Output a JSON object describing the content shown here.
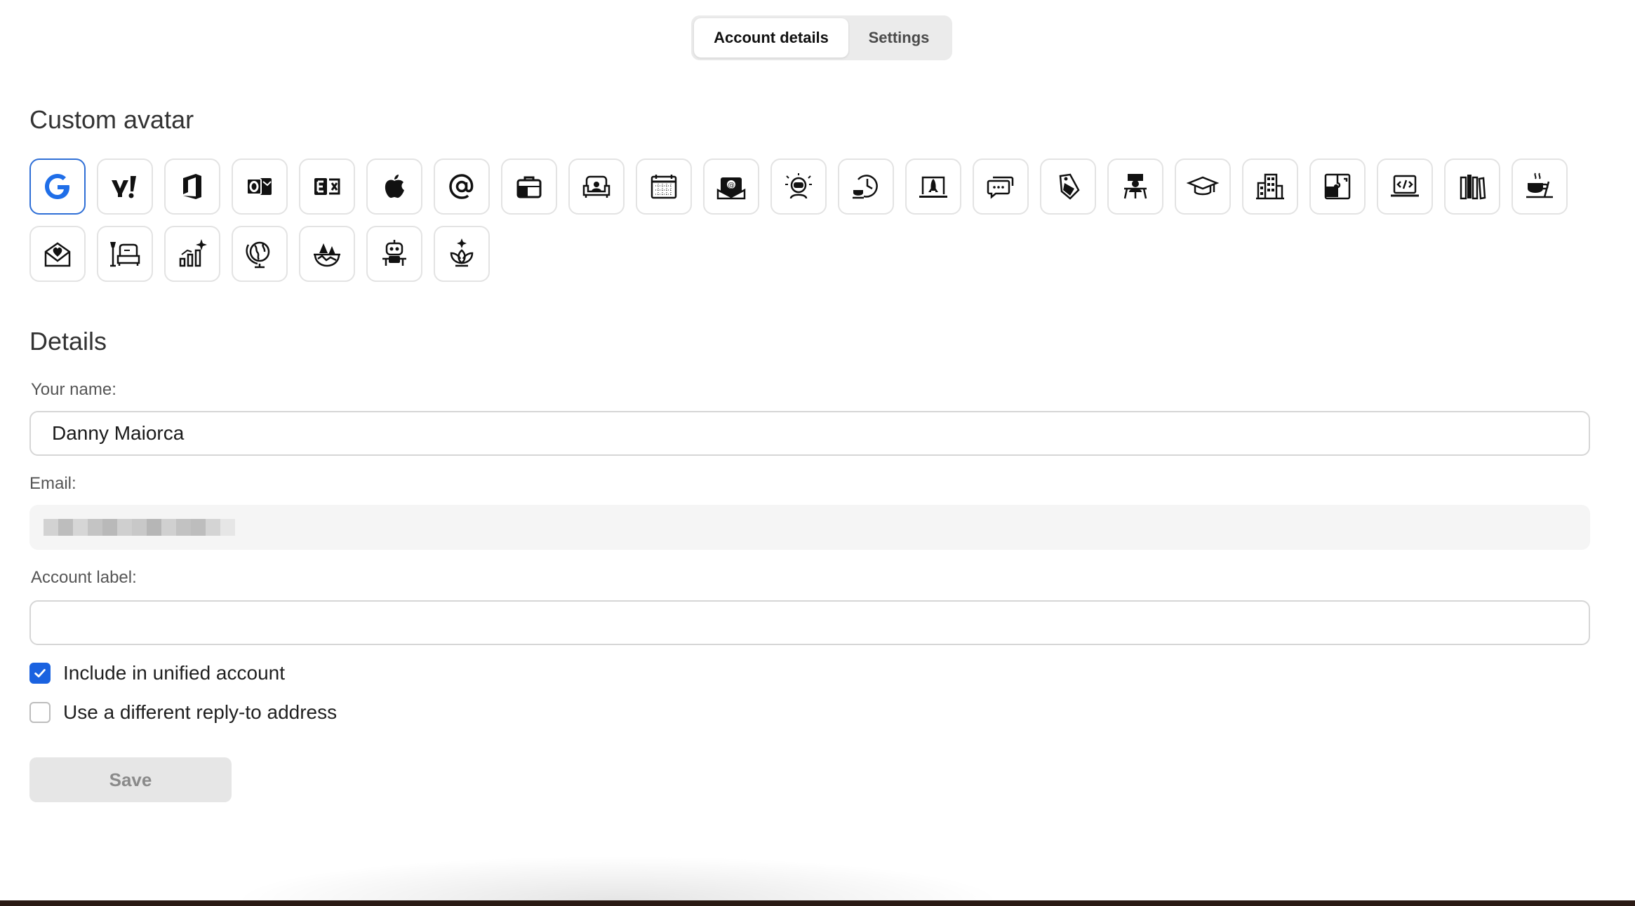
{
  "tabs": [
    {
      "label": "Account details",
      "active": true
    },
    {
      "label": "Settings",
      "active": false
    }
  ],
  "avatar_section": {
    "title": "Custom avatar",
    "row1": [
      "google-icon",
      "yahoo-icon",
      "office-icon",
      "outlook-icon",
      "exchange-icon",
      "apple-icon",
      "at-sign-icon",
      "briefcase-icon",
      "sofa-icon",
      "calendar-icon",
      "mailbox-icon",
      "astronaut-icon",
      "clock-coffee-icon",
      "rocket-laptop-icon",
      "chat-bubble-icon",
      "tag-icon",
      "presenter-icon",
      "graduation-cap-icon",
      "buildings-icon",
      "puzzle-icon",
      "code-laptop-icon",
      "books-icon",
      "coffee-cup-icon"
    ],
    "row2": [
      "love-letter-icon",
      "reading-chair-icon",
      "growth-chart-icon",
      "globe-icon",
      "nature-icon",
      "robot-icon",
      "lotus-icon"
    ],
    "selected_index": 0
  },
  "details": {
    "title": "Details",
    "name_label": "Your name:",
    "name_value": "Danny Maiorca",
    "email_label": "Email:",
    "account_label_label": "Account label:",
    "account_label_value": ""
  },
  "checkboxes": [
    {
      "label": "Include in unified account",
      "checked": true
    },
    {
      "label": "Use a different reply-to address",
      "checked": false
    }
  ],
  "save_label": "Save",
  "colors": {
    "accent": "#1a62e0",
    "selected_border": "#2f6fd6"
  }
}
